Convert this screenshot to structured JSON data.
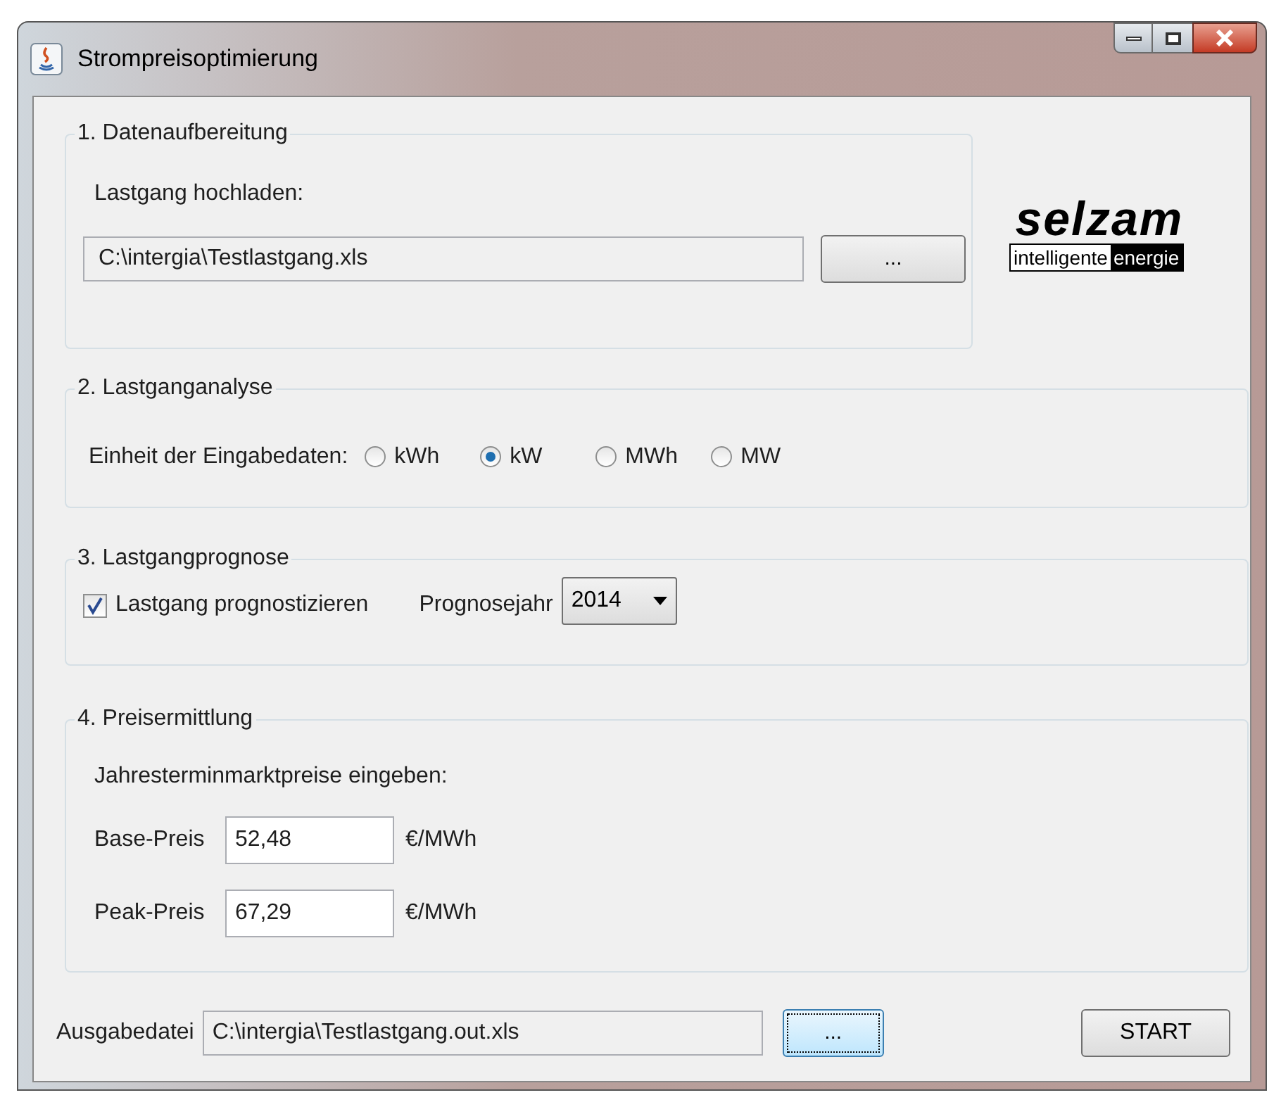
{
  "window": {
    "title": "Strompreisoptimierung"
  },
  "logo": {
    "wordmark": "selzam",
    "tagline_1": "intelligente",
    "tagline_2": "energie"
  },
  "section_1": {
    "title": "1. Datenaufbereitung",
    "label": "Lastgang hochladen:",
    "file_value": "C:\\intergia\\Testlastgang.xls",
    "browse_button": {
      "label": "...",
      "focused": false
    }
  },
  "section_2": {
    "title": "2. Lastganganalyse",
    "label": "Einheit der Eingabedaten:",
    "units": [
      {
        "label": "kWh",
        "selected": false
      },
      {
        "label": "kW",
        "selected": true
      },
      {
        "label": "MWh",
        "selected": false
      },
      {
        "label": "MW",
        "selected": false
      }
    ]
  },
  "section_3": {
    "title": "3. Lastgangprognose",
    "checkbox": {
      "label": "Lastgang prognostizieren",
      "checked": true
    },
    "year_label": "Prognosejahr",
    "year_value": "2014"
  },
  "section_4": {
    "title": "4. Preisermittlung",
    "label": "Jahresterminmarktpreise eingeben:",
    "prices": [
      {
        "label": "Base-Preis",
        "value": "52,48",
        "unit": "€/MWh"
      },
      {
        "label": "Peak-Preis",
        "value": "67,29",
        "unit": "€/MWh"
      }
    ]
  },
  "output": {
    "label": "Ausgabedatei",
    "file_value": "C:\\intergia\\Testlastgang.out.xls",
    "browse_button": {
      "label": "...",
      "focused": true
    },
    "start_button": "START"
  }
}
